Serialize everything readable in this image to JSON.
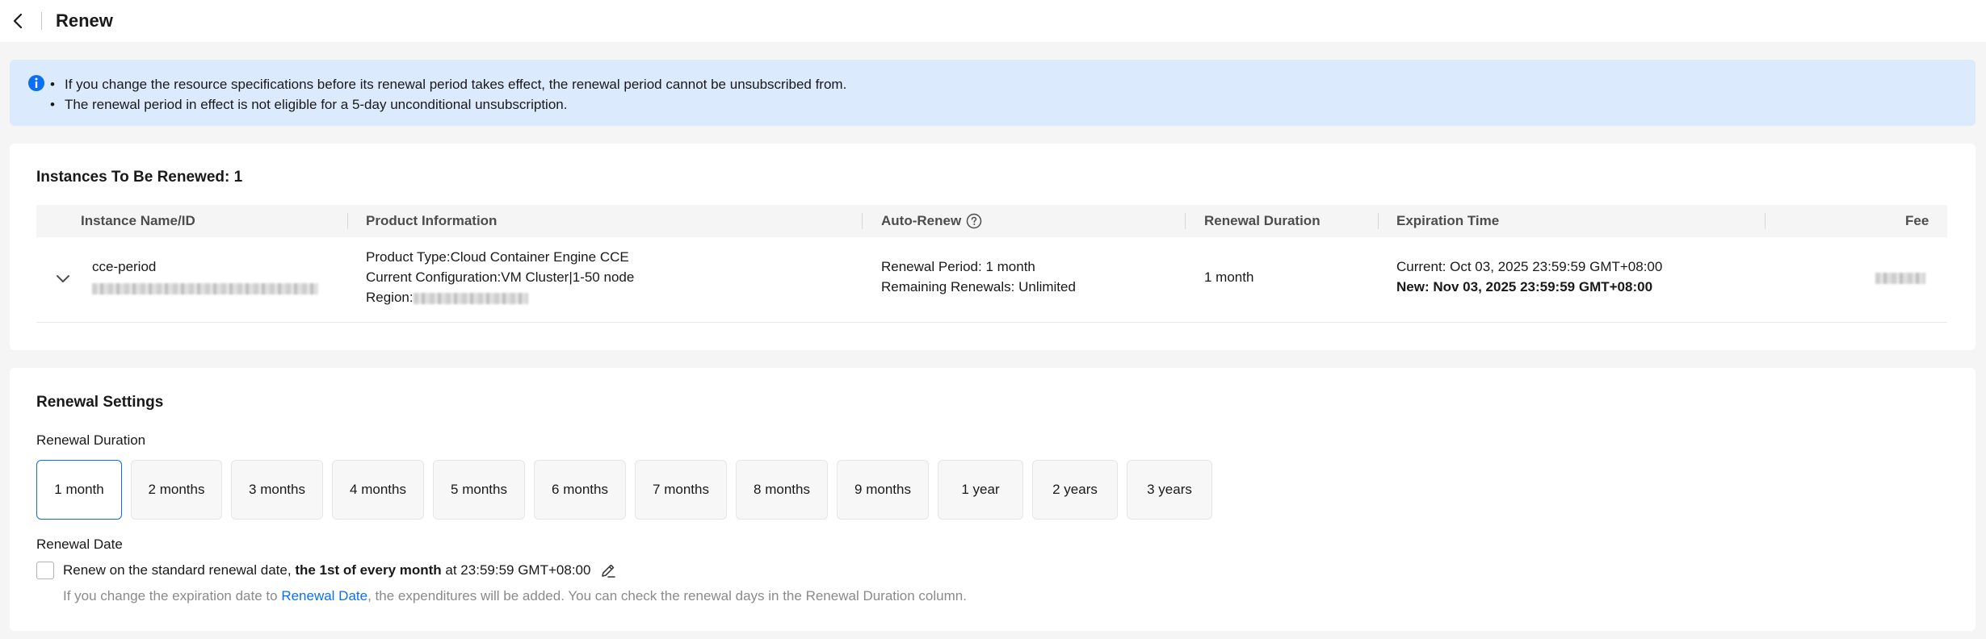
{
  "header": {
    "title": "Renew",
    "back_icon": "chevron-left-icon"
  },
  "notice": {
    "icon": "info-icon",
    "color": "#dbeafd",
    "items": [
      "If you change the resource specifications before its renewal period takes effect, the renewal period cannot be unsubscribed from.",
      "The renewal period in effect is not eligible for a 5-day unconditional unsubscription."
    ]
  },
  "instances": {
    "title": "Instances To Be Renewed: 1",
    "columns": {
      "name": "Instance Name/ID",
      "product": "Product Information",
      "auto_renew": "Auto-Renew",
      "duration": "Renewal Duration",
      "expiration": "Expiration Time",
      "fee": "Fee"
    },
    "rows": [
      {
        "name": "cce-period",
        "product_type": "Product Type:Cloud Container Engine CCE",
        "configuration": "Current Configuration:VM Cluster|1-50 node",
        "region_label": "Region:",
        "auto_renew_period": "Renewal Period: 1 month",
        "auto_renew_remaining": "Remaining Renewals: Unlimited",
        "duration": "1 month",
        "expiration_current": "Current: Oct 03, 2025 23:59:59 GMT+08:00",
        "expiration_new": "New: Nov 03, 2025 23:59:59 GMT+08:00"
      }
    ]
  },
  "settings": {
    "title": "Renewal Settings",
    "duration_label": "Renewal Duration",
    "durations": [
      "1 month",
      "2 months",
      "3 months",
      "4 months",
      "5 months",
      "6 months",
      "7 months",
      "8 months",
      "9 months",
      "1 year",
      "2 years",
      "3 years"
    ],
    "selected_duration": "1 month",
    "date_label": "Renewal Date",
    "renew_text_prefix": "Renew on the standard renewal date, ",
    "renew_text_bold": "the 1st of every month",
    "renew_text_suffix": " at 23:59:59 GMT+08:00",
    "hint_prefix": "If you change the expiration date to ",
    "hint_link": "Renewal Date",
    "hint_suffix": ", the expenditures will be added. You can check the renewal days in the Renewal Duration column.",
    "checkbox_checked": false
  },
  "colors": {
    "accent": "#0a6ff0",
    "background": "#f5f5f5"
  }
}
